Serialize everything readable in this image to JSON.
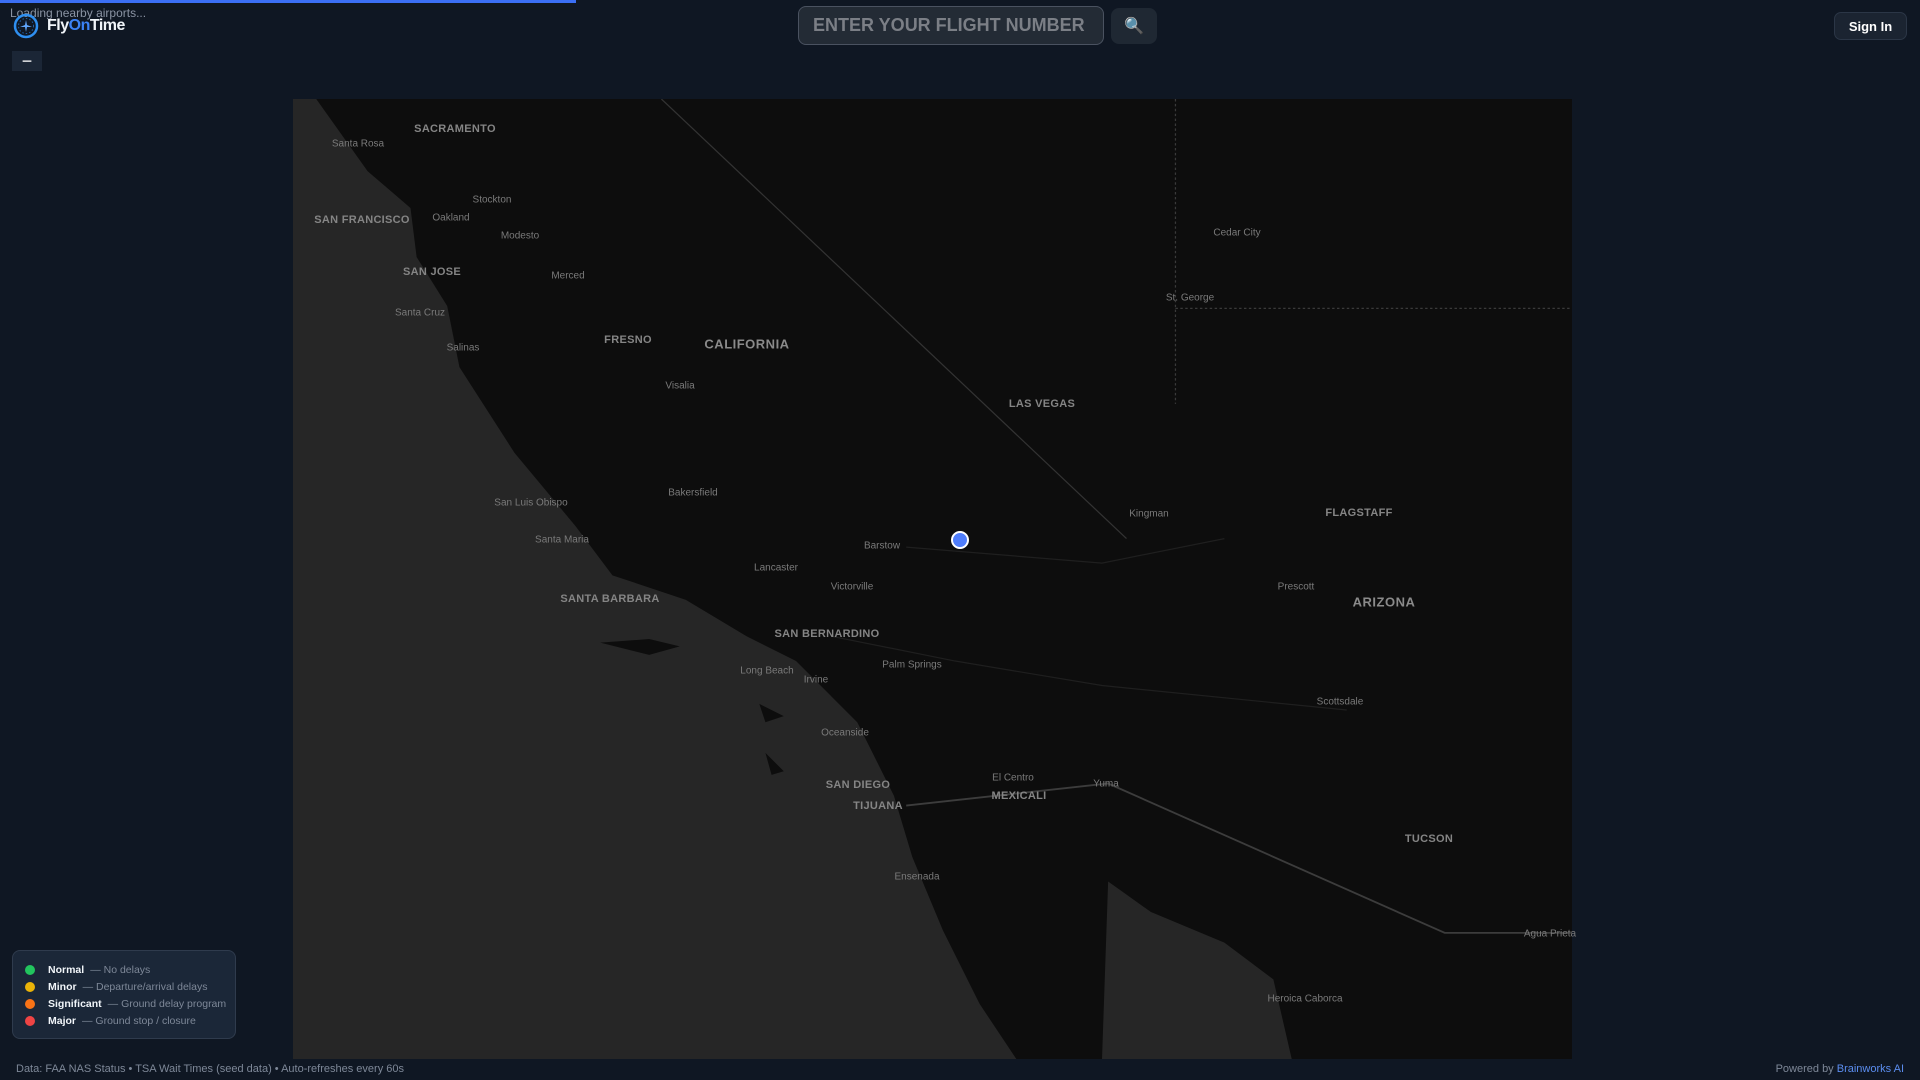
{
  "status": {
    "loading_text": "Loading nearby airports...",
    "progress_percent": 30
  },
  "header": {
    "brand_part1": "Fly",
    "brand_part2": "On",
    "brand_part3": "Time",
    "search_placeholder": "ENTER YOUR FLIGHT NUMBER",
    "search_value": "",
    "search_button_icon": "🔍",
    "sign_in_label": "Sign In",
    "zoom_out_label": "−"
  },
  "map": {
    "labels": [
      "SACRAMENTO",
      "Santa Rosa",
      "SAN FRANCISCO",
      "Oakland",
      "Stockton",
      "Modesto",
      "SAN JOSE",
      "Merced",
      "Santa Cruz",
      "Salinas",
      "FRESNO",
      "CALIFORNIA",
      "Visalia",
      "LAS VEGAS",
      "Cedar City",
      "St. George",
      "Kingman",
      "FLAGSTAFF",
      "Prescott",
      "ARIZONA",
      "Bakersfield",
      "San Luis Obispo",
      "Santa Maria",
      "Barstow",
      "Lancaster",
      "Victorville",
      "SANTA BARBARA",
      "SAN BERNARDINO",
      "Palm Springs",
      "Long Beach",
      "Irvine",
      "Scottsdale",
      "Oceanside",
      "SAN DIEGO",
      "El Centro",
      "Yuma",
      "MEXICALI",
      "TIJUANA",
      "TUCSON",
      "Ensenada",
      "Agua Prieta",
      "Heroica Caborca"
    ],
    "current_location_color": "#4f7dfb"
  },
  "legend": [
    {
      "name": "Normal",
      "desc": "— No delays",
      "color": "#22c55e"
    },
    {
      "name": "Minor",
      "desc": "— Departure/arrival delays",
      "color": "#eab308"
    },
    {
      "name": "Significant",
      "desc": "— Ground delay program",
      "color": "#f97316"
    },
    {
      "name": "Major",
      "desc": "— Ground stop / closure",
      "color": "#ef4444"
    }
  ],
  "footer": {
    "data_sources": "Data: FAA NAS Status • TSA Wait Times (seed data) • Auto-refreshes every 60s",
    "powered_by": "Powered by ",
    "powered_by_link": "Brainworks AI"
  }
}
